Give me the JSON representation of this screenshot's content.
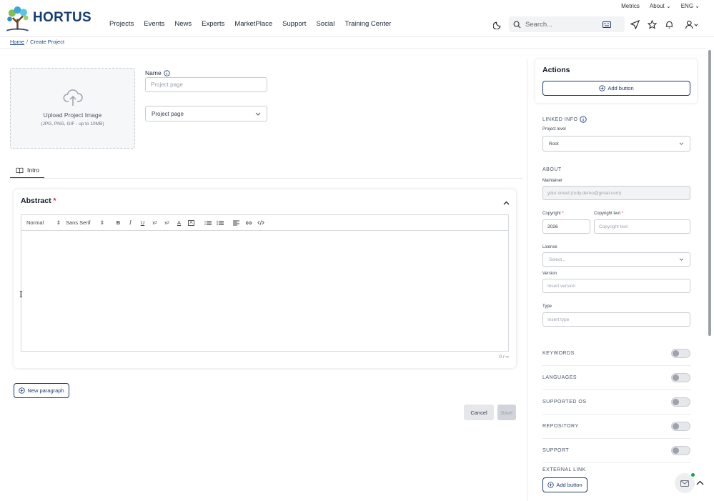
{
  "app": {
    "logo_text": "HORTUS",
    "nav": [
      "Projects",
      "Events",
      "News",
      "Experts",
      "MarketPlace",
      "Support",
      "Social",
      "Training Center"
    ],
    "util": {
      "metrics": "Metrics",
      "about": "About",
      "lang": "ENG"
    },
    "search_placeholder": "Search..."
  },
  "breadcrumb": {
    "home": "Home",
    "sep": "/",
    "current": "Create Project"
  },
  "upload": {
    "title": "Upload Project Image",
    "hint": "(JPG, PNG, GIF - up to 10MB)"
  },
  "form": {
    "name_label": "Name",
    "name_placeholder": "Project page",
    "type_value": "Project page"
  },
  "tabs": {
    "intro": "Intro"
  },
  "abstract": {
    "title": "Abstract",
    "required_mark": "*",
    "toolbar": {
      "format": "Normal",
      "font": "Sans Serif"
    },
    "counter": "0 / ∞"
  },
  "buttons": {
    "new_paragraph": "New paragraph",
    "cancel": "Cancel",
    "save": "Save",
    "add_button": "Add button"
  },
  "sidebar": {
    "actions_title": "Actions",
    "linked_info": "LINKED INFO",
    "project_level_label": "Project level",
    "project_level_value": "Root",
    "about": "ABOUT",
    "maintainer_label": "Maintainer",
    "maintainer_value": "ydur omed (rudy.demo@gmail.com)",
    "copyright_label": "Copyright",
    "copyright_value": "2026",
    "copyright_text_label": "Copyright text",
    "copyright_text_placeholder": "Copyright text",
    "license_label": "License",
    "license_placeholder": "Select...",
    "version_label": "Version",
    "version_placeholder": "Insert version",
    "type_label": "Type",
    "type_placeholder": "Insert type",
    "toggles": [
      "KEYWORDS",
      "LANGUAGES",
      "SUPPORTED OS",
      "REPOSITORY",
      "SUPPORT"
    ],
    "external_link": "EXTERNAL LINK"
  },
  "colors": {
    "brand": "#143d73",
    "accent": "#1e3a6e",
    "required": "#dc2626",
    "online": "#16a34a"
  }
}
